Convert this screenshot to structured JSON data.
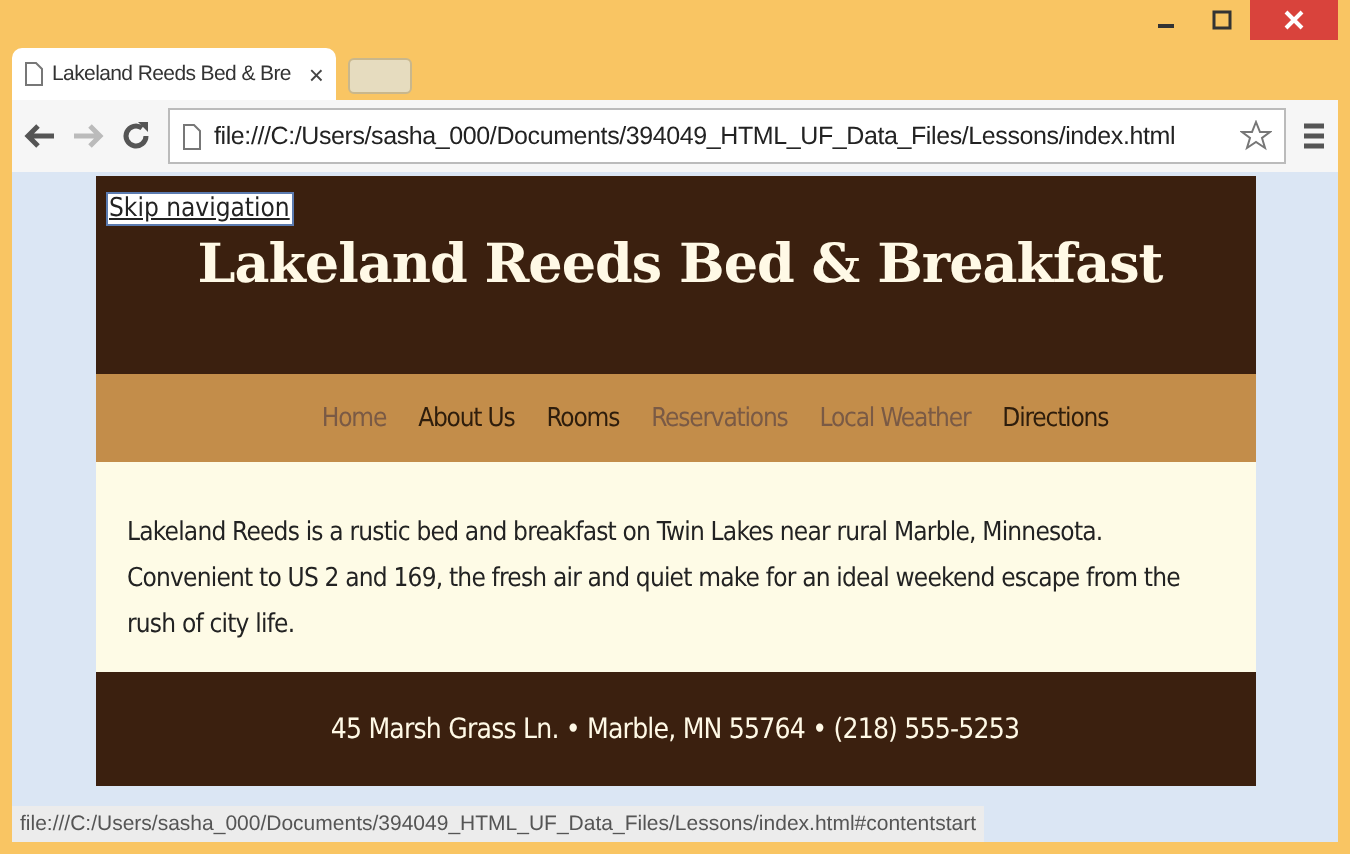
{
  "window": {
    "tab_title": "Lakeland Reeds Bed & Bre",
    "tab_close": "×",
    "address": "file:///C:/Users/sasha_000/Documents/394049_HTML_UF_Data_Files/Lessons/index.html"
  },
  "page": {
    "skip_link": "Skip navigation",
    "title": "Lakeland Reeds Bed & Breakfast",
    "nav": [
      {
        "label": "Home",
        "visited": true
      },
      {
        "label": "About Us",
        "visited": false
      },
      {
        "label": "Rooms",
        "visited": false
      },
      {
        "label": "Reservations",
        "visited": true
      },
      {
        "label": "Local Weather",
        "visited": true
      },
      {
        "label": "Directions",
        "visited": false
      }
    ],
    "intro": "Lakeland Reeds is a rustic bed and breakfast on Twin Lakes near rural Marble, Minnesota. Convenient to US 2 and 169, the fresh air and quiet make for an ideal weekend escape from the rush of city life.",
    "footer": "45 Marsh Grass Ln. • Marble, MN 55764 • (218) 555-5253"
  },
  "status_bar": "file:///C:/Users/sasha_000/Documents/394049_HTML_UF_Data_Files/Lessons/index.html#contentstart"
}
